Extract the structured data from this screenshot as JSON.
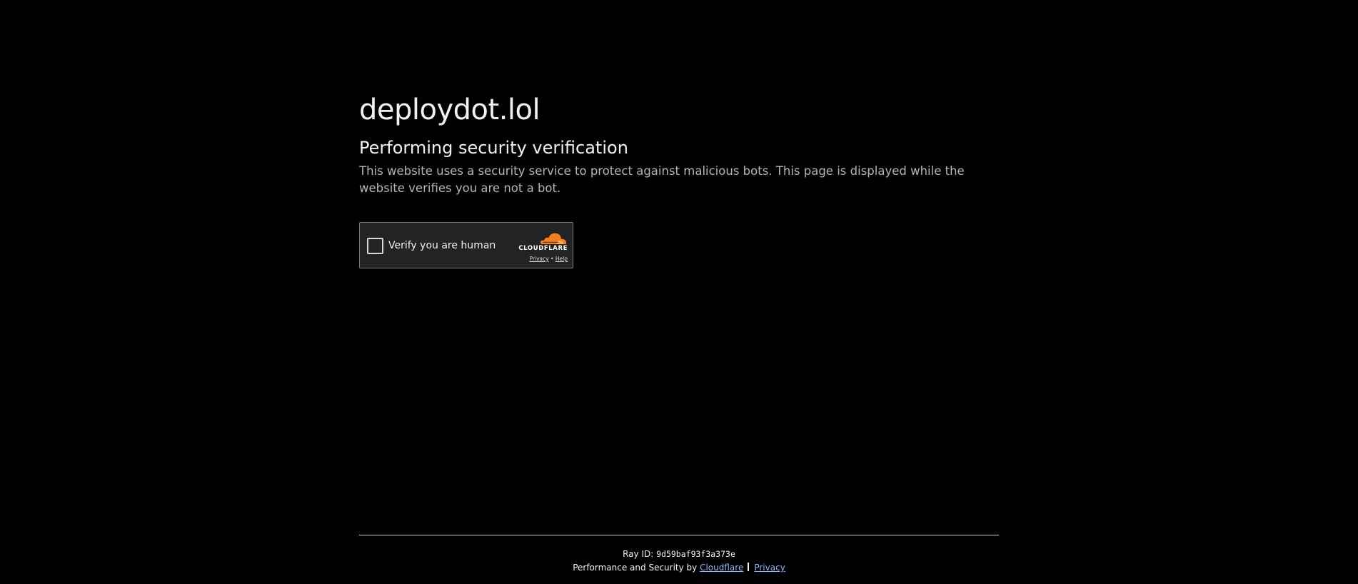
{
  "site": {
    "title": "deploydot.lol"
  },
  "verification": {
    "heading": "Performing security verification",
    "description": "This website uses a security service to protect against malicious bots. This page is displayed while the website verifies you are not a bot."
  },
  "widget": {
    "checkbox_label": "Verify you are human",
    "brand_name": "CLOUDFLARE",
    "privacy_link": "Privacy",
    "separator": "•",
    "help_link": "Help",
    "brand_icon": "cloudflare-cloud-icon"
  },
  "footer": {
    "ray_label": "Ray ID:",
    "ray_id": "9d59baf93f3a373e",
    "performance_prefix": "Performance and Security by",
    "cloudflare_link": "Cloudflare",
    "privacy_link": "Privacy"
  },
  "colors": {
    "background": "#000000",
    "text": "#f2f2f2",
    "muted_text": "#b5b5b5",
    "widget_bg": "#232323",
    "cloudflare_orange": "#f38020",
    "link": "#8ab4f8"
  }
}
